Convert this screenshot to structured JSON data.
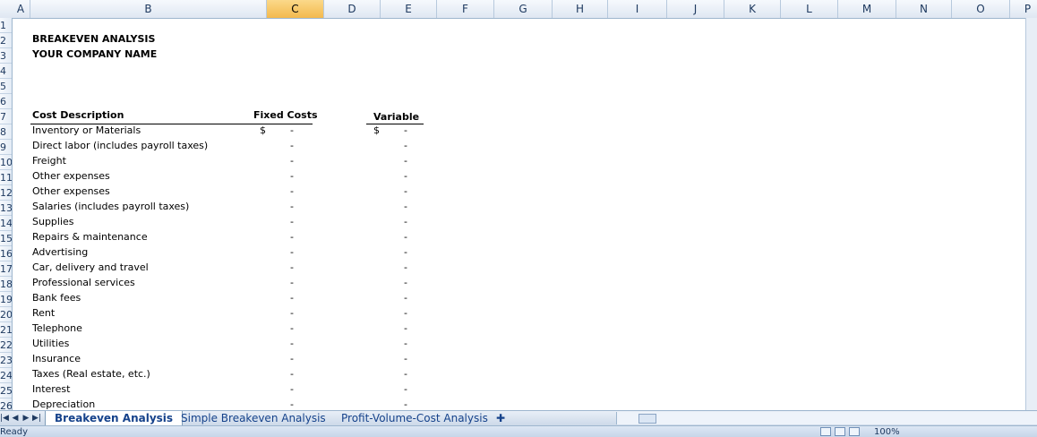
{
  "columns": [
    "A",
    "B",
    "C",
    "D",
    "E",
    "F",
    "G",
    "H",
    "I",
    "J",
    "K",
    "L",
    "M",
    "N",
    "O",
    "P"
  ],
  "selected_column": "C",
  "rows": [
    "1",
    "2",
    "3",
    "4",
    "5",
    "6",
    "7",
    "8",
    "9",
    "10",
    "11",
    "12",
    "13",
    "14",
    "15",
    "16",
    "17",
    "18",
    "19",
    "20",
    "21",
    "22",
    "23",
    "24",
    "25",
    "26"
  ],
  "sheet": {
    "title": "BREAKEVEN ANALYSIS",
    "company": "YOUR COMPANY NAME",
    "header_cost": "Cost Description",
    "header_fixed": "Fixed Costs",
    "header_variable": "Variable",
    "currency": "$",
    "dash": "-",
    "items": [
      "Inventory or Materials",
      "Direct labor (includes payroll taxes)",
      "Freight",
      "Other expenses",
      "Other expenses",
      "Salaries (includes payroll taxes)",
      "Supplies",
      "Repairs & maintenance",
      "Advertising",
      "Car, delivery and travel",
      "Professional services",
      "Bank fees",
      "Rent",
      "Telephone",
      "Utilities",
      "Insurance",
      "Taxes (Real estate, etc.)",
      "Interest",
      "Depreciation"
    ]
  },
  "tabs": [
    "Breakeven Analysis",
    "Simple Breakeven Analysis",
    "Profit-Volume-Cost Analysis"
  ],
  "active_tab": "Breakeven Analysis",
  "status": {
    "ready": "Ready",
    "zoom": "100%"
  }
}
